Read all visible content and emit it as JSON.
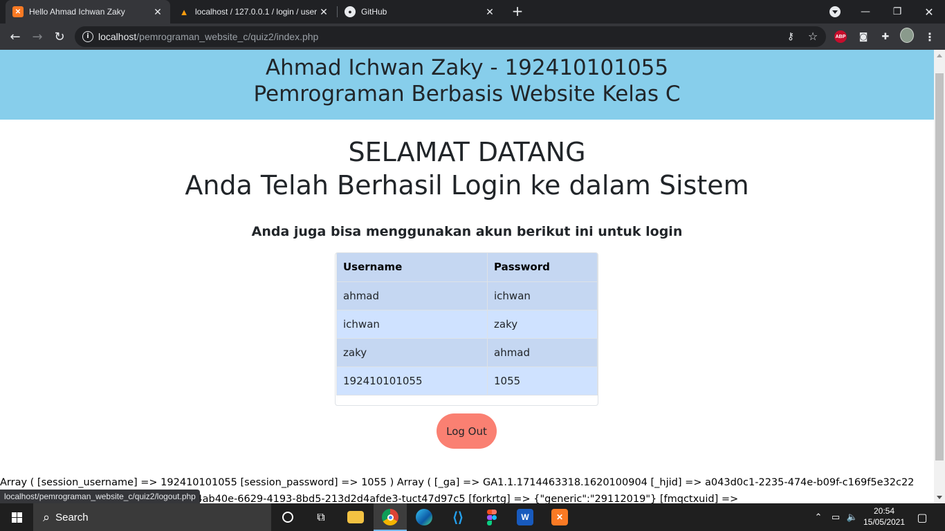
{
  "browser": {
    "tabs": [
      {
        "title": "Hello Ahmad Ichwan Zaky",
        "favicon": "xampp-icon",
        "active": true
      },
      {
        "title": "localhost / 127.0.0.1 / login / user",
        "favicon": "phpmyadmin-icon",
        "active": false
      },
      {
        "title": "GitHub",
        "favicon": "github-icon",
        "active": false
      }
    ],
    "tab_close": "✕",
    "new_tab": "+",
    "url_host": "localhost",
    "url_path": "/pemrograman_website_c/quiz2/index.php",
    "abp_label": "ABP"
  },
  "page": {
    "header_line1": "Ahmad Ichwan Zaky - 192410101055",
    "header_line2": "Pemrograman Berbasis Website Kelas C",
    "welcome_line1": "SELAMAT DATANG",
    "welcome_line2": "Anda Telah Berhasil Login ke dalam Sistem",
    "subtitle": "Anda juga bisa menggunakan akun berikut ini untuk login",
    "table": {
      "headers": [
        "Username",
        "Password"
      ],
      "rows": [
        [
          "ahmad",
          "ichwan"
        ],
        [
          "ichwan",
          "zaky"
        ],
        [
          "zaky",
          "ahmad"
        ],
        [
          "192410101055",
          "1055"
        ]
      ]
    },
    "logout_label": "Log Out",
    "dump_line1": "Array ( [session_username] => 192410101055 [session_password] => 1055 ) Array ( [_ga] => GA1.1.1714463318.1620100904 [_hjid] => a043d0c1-2235-474e-b09f-c169f5e32c22",
    "dump_line2": "[hubspotutk] => sequel%3Auser-id=f64ab40e-6629-4193-8bd5-213d2d4afde3-tuct47d97c5 [forkrtg] => {\"generic\":\"29112019\"} [fmqctxuid] =>"
  },
  "status_url": "localhost/pemrograman_website_c/quiz2/logout.php",
  "taskbar": {
    "search_label": "Search",
    "time": "20:54",
    "date": "15/05/2021"
  }
}
